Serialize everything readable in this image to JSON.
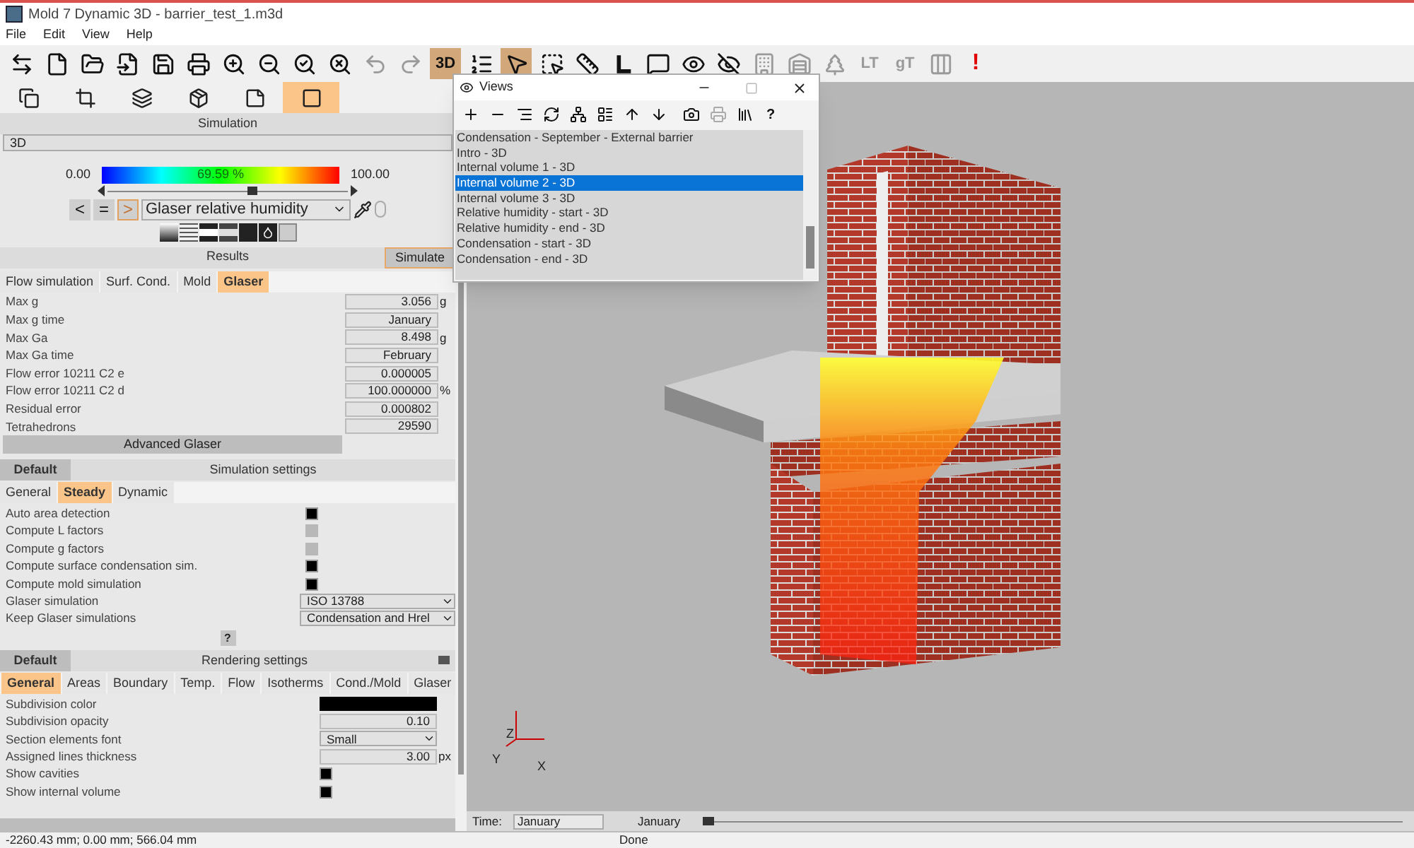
{
  "window": {
    "title": "Mold 7 Dynamic 3D - barrier_test_1.m3d"
  },
  "menu": [
    "File",
    "Edit",
    "View",
    "Help"
  ],
  "toolbar": [
    {
      "selected": false,
      "disabled": false
    },
    {
      "selected": false,
      "disabled": false
    },
    {
      "selected": false,
      "disabled": false
    },
    {
      "selected": false,
      "disabled": false
    },
    {
      "selected": false,
      "disabled": false
    },
    {
      "selected": false,
      "disabled": false
    },
    {
      "selected": false,
      "disabled": false
    },
    {
      "selected": false,
      "disabled": false
    },
    {
      "selected": false,
      "disabled": false
    },
    {
      "selected": false,
      "disabled": false
    },
    {
      "selected": false,
      "disabled": true
    },
    {
      "selected": false,
      "disabled": true
    },
    {
      "label": "3D",
      "selected": true,
      "disabled": false
    },
    {
      "selected": false,
      "disabled": false
    },
    {
      "selected": true,
      "disabled": false
    },
    {
      "selected": false,
      "disabled": false
    },
    {
      "selected": false,
      "disabled": false
    },
    {
      "selected": false,
      "disabled": false
    },
    {
      "selected": false,
      "disabled": false
    },
    {
      "selected": false,
      "disabled": false
    },
    {
      "selected": false,
      "disabled": false
    },
    {
      "selected": false,
      "disabled": true
    },
    {
      "selected": false,
      "disabled": true
    },
    {
      "selected": false,
      "disabled": true
    },
    {
      "label": "LT",
      "selected": false,
      "disabled": true
    },
    {
      "label": "gT",
      "selected": false,
      "disabled": true
    },
    {
      "selected": false,
      "disabled": true
    },
    {
      "label": "!",
      "selected": false,
      "disabled": false
    }
  ],
  "modes": [
    {
      "selected": false
    },
    {
      "selected": false
    },
    {
      "selected": false
    },
    {
      "selected": false
    },
    {
      "selected": false
    },
    {
      "selected": true
    }
  ],
  "simulation": {
    "title": "Simulation",
    "view_select": "3D",
    "scale_min": "0.00",
    "scale_reading": "69.59 %",
    "scale_max": "100.00",
    "level": 0.6,
    "nav": [
      {
        "label": "<",
        "selected": false
      },
      {
        "label": "=",
        "selected": false
      },
      {
        "label": ">",
        "selected": true
      }
    ],
    "result_select": "Glaser relative humidity"
  },
  "results": {
    "title": "Results",
    "simulate_button": "Simulate",
    "tabs": [
      {
        "label": "Flow simulation",
        "selected": false
      },
      {
        "label": "Surf. Cond.",
        "selected": false
      },
      {
        "label": "Mold",
        "selected": false
      },
      {
        "label": "Glaser",
        "selected": true
      }
    ],
    "rows": [
      {
        "label": "Max g",
        "value": "3.056",
        "unit": "g"
      },
      {
        "label": "Max g time",
        "value": "January"
      },
      {
        "label": "Max Ga",
        "value": "8.498",
        "unit": "g"
      },
      {
        "label": "Max Ga time",
        "value": "February"
      },
      {
        "label": "Flow error 10211 C2 e",
        "value": "0.000005"
      },
      {
        "label": "Flow error 10211 C2 d",
        "value": "100.000000",
        "unit": "%"
      },
      {
        "label": "Residual error",
        "value": "0.000802"
      },
      {
        "label": "Tetrahedrons",
        "value": "29590"
      }
    ],
    "advanced_button": "Advanced Glaser"
  },
  "simulation_settings": {
    "default_button": "Default",
    "title": "Simulation settings",
    "tabs": [
      {
        "label": "General",
        "selected": false
      },
      {
        "label": "Steady",
        "selected": true
      },
      {
        "label": "Dynamic",
        "selected": false
      }
    ],
    "rows": [
      {
        "kind": "checkbox",
        "label": "Auto area detection",
        "checked": true,
        "disabled": false
      },
      {
        "kind": "checkbox",
        "label": "Compute L factors",
        "checked": false,
        "disabled": true
      },
      {
        "kind": "checkbox",
        "label": "Compute g factors",
        "checked": false,
        "disabled": true
      },
      {
        "kind": "checkbox",
        "label": "Compute surface condensation sim.",
        "checked": true,
        "disabled": false
      },
      {
        "kind": "checkbox",
        "label": "Compute mold simulation",
        "checked": true,
        "disabled": false
      },
      {
        "kind": "select",
        "label": "Glaser simulation",
        "value": "ISO 13788"
      },
      {
        "kind": "select",
        "label": "Keep Glaser simulations",
        "value": "Condensation and Hrel"
      }
    ],
    "help_button": "?"
  },
  "rendering_settings": {
    "default_button": "Default",
    "title": "Rendering settings",
    "tabs": [
      {
        "label": "General",
        "selected": true
      },
      {
        "label": "Areas",
        "selected": false
      },
      {
        "label": "Boundary",
        "selected": false
      },
      {
        "label": "Temp.",
        "selected": false
      },
      {
        "label": "Flow",
        "selected": false
      },
      {
        "label": "Isotherms",
        "selected": false
      },
      {
        "label": "Cond./Mold",
        "selected": false
      },
      {
        "label": "Glaser",
        "selected": false
      }
    ],
    "rows": [
      {
        "kind": "color",
        "label": "Subdivision color",
        "color": "#000000"
      },
      {
        "kind": "value",
        "label": "Subdivision opacity",
        "value": "0.10"
      },
      {
        "kind": "select",
        "label": "Section elements font",
        "value": "Small"
      },
      {
        "kind": "value",
        "label": "Assigned lines thickness",
        "value": "3.00",
        "unit": "px"
      },
      {
        "kind": "checkbox",
        "label": "Show cavities",
        "checked": true
      },
      {
        "kind": "checkbox",
        "label": "Show internal volume",
        "checked": true
      }
    ]
  },
  "views_dialog": {
    "title": "Views",
    "tools": [
      {
        "disabled": false
      },
      {
        "disabled": false
      },
      {
        "disabled": false
      },
      {
        "disabled": false
      },
      {
        "disabled": false
      },
      {
        "disabled": false
      },
      {
        "disabled": false
      },
      {
        "disabled": false
      },
      {
        "disabled": false
      },
      {
        "disabled": true
      },
      {
        "disabled": false
      },
      {
        "label": "?",
        "disabled": false
      }
    ],
    "items": [
      {
        "label": "Condensation - September - External barrier",
        "selected": false
      },
      {
        "label": "Intro - 3D",
        "selected": false
      },
      {
        "label": "Internal volume 1 - 3D",
        "selected": false
      },
      {
        "label": "Internal volume 2 - 3D",
        "selected": true
      },
      {
        "label": "Internal volume 3 - 3D",
        "selected": false
      },
      {
        "label": "Relative humidity - start - 3D",
        "selected": false
      },
      {
        "label": "Relative humidity - end - 3D",
        "selected": false
      },
      {
        "label": "Condensation - start - 3D",
        "selected": false
      },
      {
        "label": "Condensation - end - 3D",
        "selected": false
      }
    ]
  },
  "viewport": {
    "axes": [
      "Z",
      "Y",
      "X"
    ]
  },
  "timeline": {
    "label": "Time:",
    "value": "January",
    "reading": "January",
    "level": 0.0
  },
  "status_bar": {
    "coordinates": "-2260.43 mm; 0.00 mm; 566.04 mm",
    "message": "Done"
  }
}
